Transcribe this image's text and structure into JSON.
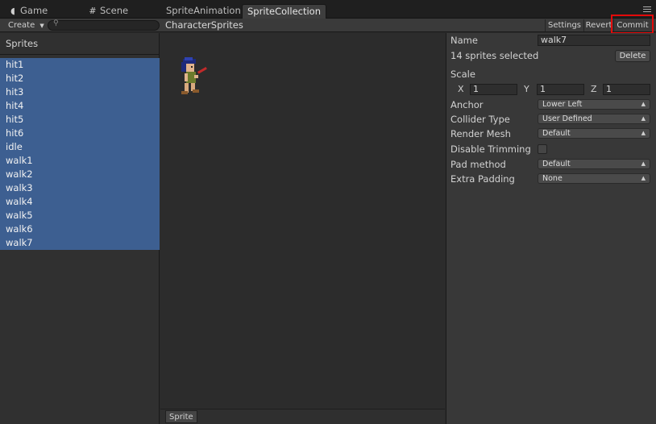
{
  "tabs": {
    "game": "Game",
    "scene": "Scene",
    "sprite_animation": "SpriteAnimation",
    "sprite_collection": "SpriteCollection"
  },
  "toolbar": {
    "create": "Create",
    "collection_name": "CharacterSprites",
    "settings": "Settings",
    "revert": "Revert",
    "commit": "Commit"
  },
  "sidebar": {
    "title": "Sprites",
    "items": [
      "hit1",
      "hit2",
      "hit3",
      "hit4",
      "hit5",
      "hit6",
      "idle",
      "walk1",
      "walk2",
      "walk3",
      "walk4",
      "walk5",
      "walk6",
      "walk7"
    ],
    "selection_color": "#3d5f91"
  },
  "preview": {
    "footer_label": "Sprite"
  },
  "inspector": {
    "name_label": "Name",
    "name_value": "walk7",
    "selection_info": "14 sprites selected",
    "delete": "Delete",
    "scale_label": "Scale",
    "x_label": "X",
    "x_value": "1",
    "y_label": "Y",
    "y_value": "1",
    "z_label": "Z",
    "z_value": "1",
    "anchor_label": "Anchor",
    "anchor_value": "Lower Left",
    "collider_label": "Collider Type",
    "collider_value": "User Defined",
    "render_mesh_label": "Render Mesh",
    "render_mesh_value": "Default",
    "disable_trimming_label": "Disable Trimming",
    "pad_method_label": "Pad method",
    "pad_method_value": "Default",
    "extra_padding_label": "Extra Padding",
    "extra_padding_value": "None"
  },
  "highlight_color": "#e40a0a"
}
